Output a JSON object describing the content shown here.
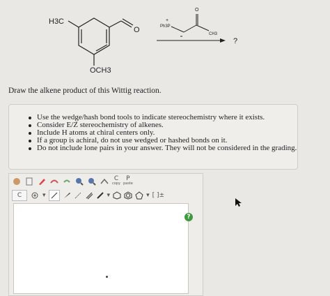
{
  "reaction": {
    "h3c": "H3C",
    "aldehyde_o": "O",
    "ylide_ph3p": "Ph3P",
    "ylide_plus": "+",
    "ylide_ketone_o": "O",
    "ylide_ch3": "CH3",
    "unknown_product": "?",
    "och3": "OCH3"
  },
  "prompt": "Draw the alkene product of this Wittig reaction.",
  "instructions": [
    "Use the wedge/hash bond tools to indicate stereochemistry where it exists.",
    "Consider E/Z stereochemistry of alkenes.",
    "Include H atoms at chiral centers only.",
    "If a group is achiral, do not use wedged or hashed bonds on it.",
    "Do not include lone pairs in your answer. They will not be considered in the grading."
  ],
  "editor": {
    "toolbar1": {
      "c_label": "C",
      "c_sub": "copy",
      "p_label": "P",
      "p_sub": "paste"
    },
    "toolbar2": {
      "c_field": "C",
      "ring_text": "[ ]±"
    },
    "help": "?"
  },
  "icons": [
    "move-icon",
    "erase-icon",
    "lasso-icon",
    "rotate-icon",
    "zoom-in-icon",
    "zoom-out-icon",
    "plus-charge-icon",
    "single-bond-icon",
    "wedge-bond-icon",
    "hash-bond-icon",
    "double-bond-icon",
    "ring-icons",
    "bracket-icon"
  ],
  "colors": {
    "help_button": "#3e9a3e"
  }
}
